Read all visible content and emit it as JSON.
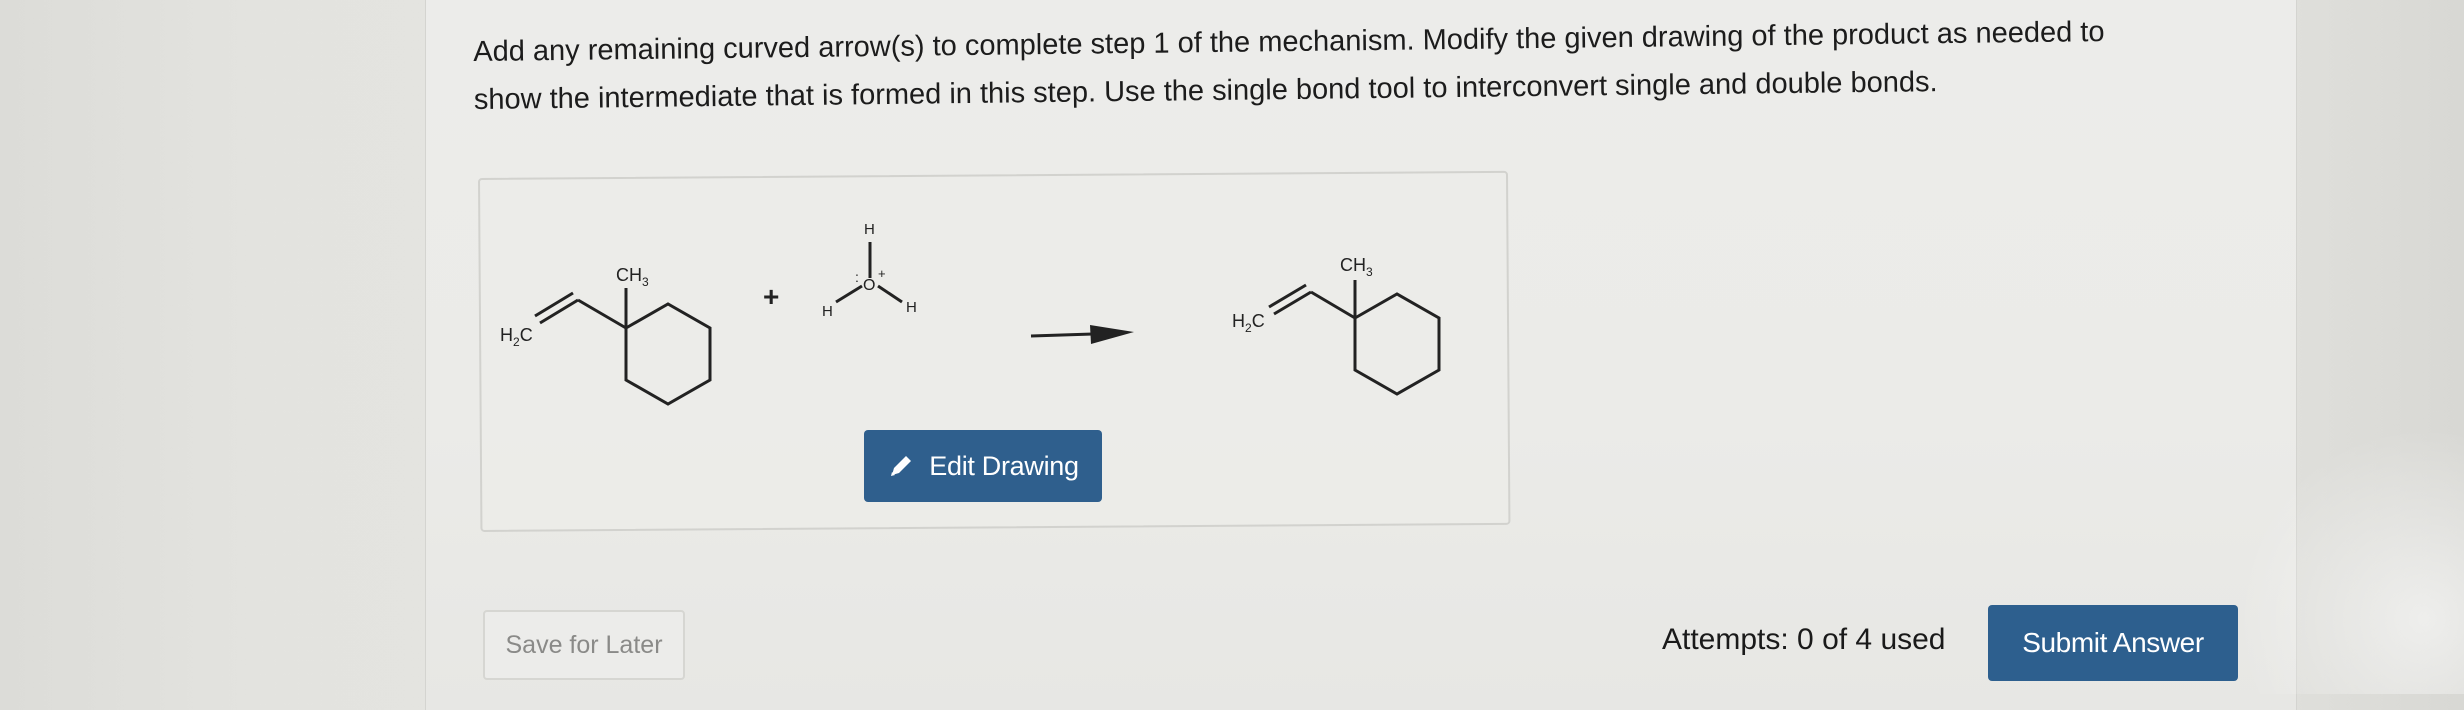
{
  "question": {
    "line1": "Add any remaining curved arrow(s) to complete step 1 of the mechanism. Modify the given drawing of the product as needed to",
    "line2": "show the intermediate that is formed in this step. Use the single bond tool to interconvert single and double bonds."
  },
  "scheme": {
    "reactant": {
      "methyl_label": "CH",
      "methyl_sub": "3",
      "methylene_label": "H",
      "methylene_sub": "2",
      "methylene_end": "C"
    },
    "plus": "+",
    "hydronium": {
      "top_h": "H",
      "left_h": "H",
      "right_h": "H",
      "oxygen": "O",
      "charge": "+",
      "lone_pair": ":"
    },
    "product": {
      "methyl_label": "CH",
      "methyl_sub": "3",
      "methylene_label": "H",
      "methylene_sub": "2",
      "methylene_end": "C"
    }
  },
  "edit_drawing": {
    "label": "Edit Drawing",
    "icon": "pencil-icon"
  },
  "footer": {
    "save_label": "Save for Later",
    "attempts_text": "Attempts: 0 of 4 used",
    "submit_label": "Submit Answer"
  },
  "colors": {
    "button_blue": "#2f5f8d",
    "text": "#1c1c1c",
    "muted_text": "#8a8a88"
  }
}
